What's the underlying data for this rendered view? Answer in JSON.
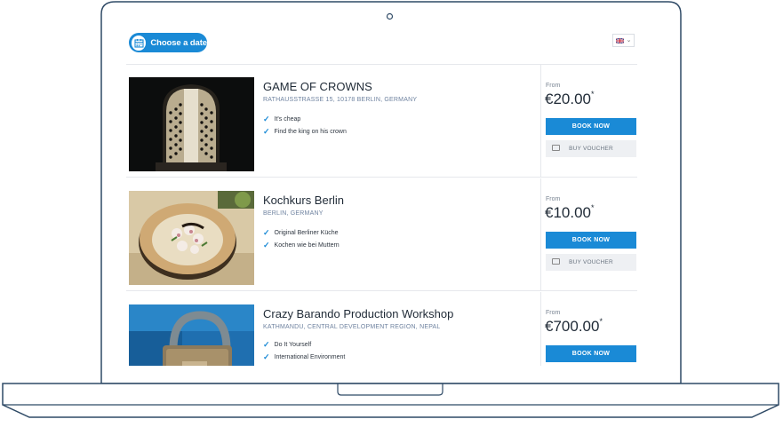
{
  "header": {
    "date_button_label": "Choose a date",
    "language": "English (UK)"
  },
  "listings": [
    {
      "title": "GAME OF CROWNS",
      "address": "RATHAUSSTRASSE 15, 10178 BERLIN, GERMANY",
      "features": [
        "It's cheap",
        "Find the king on his crown"
      ],
      "from_label": "From",
      "price": "€20.00",
      "price_mark": "*",
      "book_label": "BOOK NOW",
      "voucher_label": "BUY VOUCHER"
    },
    {
      "title": "Kochkurs Berlin",
      "address": "BERLIN, GERMANY",
      "features": [
        "Original Berliner Küche",
        "Kochen wie bei Muttern"
      ],
      "from_label": "From",
      "price": "€10.00",
      "price_mark": "*",
      "book_label": "BOOK NOW",
      "voucher_label": "BUY VOUCHER"
    },
    {
      "title": "Crazy Barando Production Workshop",
      "address": "KATHMANDU, CENTRAL DEVELOPMENT REGION, NEPAL",
      "features": [
        "Do It Yourself",
        "International Environment"
      ],
      "from_label": "From",
      "price": "€700.00",
      "price_mark": "*",
      "book_label": "BOOK NOW"
    }
  ],
  "colors": {
    "accent": "#1a8ad6",
    "laptop_outline": "#2f4a66"
  },
  "icons": {
    "calendar": "calendar-icon",
    "check": "check-icon",
    "voucher": "voucher-icon",
    "flag": "uk-flag-icon",
    "chevron": "chevron-down-icon"
  }
}
